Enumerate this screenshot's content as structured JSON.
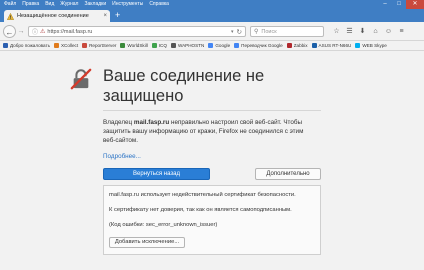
{
  "menu": [
    "Файл",
    "Правка",
    "Вид",
    "Журнал",
    "Закладки",
    "Инструменты",
    "Справка"
  ],
  "window_controls": {
    "minimize": "–",
    "maximize": "□",
    "close": "✕"
  },
  "tab": {
    "title": "Незащищённое соединение",
    "close": "×",
    "new_tab": "+"
  },
  "nav": {
    "back_glyph": "←",
    "forward_glyph": "→",
    "url": "https://mail.fasp.ru",
    "info_glyph": "ⓘ",
    "lock_glyph": "⚠",
    "dropdown_glyph": "▾",
    "reload_glyph": "↻",
    "search_icon": "⚲",
    "search_placeholder": "Поиск",
    "tool_icons": [
      {
        "name": "bookmark-star-icon",
        "glyph": "☆"
      },
      {
        "name": "reading-list-icon",
        "glyph": "☰"
      },
      {
        "name": "download-icon",
        "glyph": "⬇"
      },
      {
        "name": "home-icon",
        "glyph": "⌂"
      },
      {
        "name": "chat-icon",
        "glyph": "☺"
      },
      {
        "name": "menu-icon",
        "glyph": "≡"
      }
    ]
  },
  "bookmarks": [
    {
      "label": "Добро пожаловать",
      "color": "#2b5fb0"
    },
    {
      "label": "XCollect",
      "color": "#e07b1c"
    },
    {
      "label": "ReportServer",
      "color": "#c94a3d"
    },
    {
      "label": "WorldSkill",
      "color": "#3a8a3a"
    },
    {
      "label": "ICQ",
      "color": "#3fa34d"
    },
    {
      "label": "WAPHOSTN",
      "color": "#555555"
    },
    {
      "label": "Google",
      "color": "#4285f4"
    },
    {
      "label": "Переводчик Google",
      "color": "#4285f4"
    },
    {
      "label": "Zabbix",
      "color": "#b0272d"
    },
    {
      "label": "ASUS RT-N66U",
      "color": "#1b5fa8"
    },
    {
      "label": "WEB Skype",
      "color": "#00aff0"
    }
  ],
  "page": {
    "heading": "Ваше соединение не защищено",
    "description_owner": "Владелец",
    "description_domain": "mail.fasp.ru",
    "description_rest": "неправильно настроил свой веб-сайт. Чтобы защитить вашу информацию от кражи, Firefox не соединился с этим веб-сайтом.",
    "more_link": "Подробнее...",
    "back_button": "Вернуться назад",
    "advanced_button": "Дополнительно",
    "advanced": {
      "line1": "mail.fasp.ru использует недействительный сертификат безопасности.",
      "line2": "К сертификату нет доверия, так как он является самоподписанным.",
      "line3": "(Код ошибки: sec_error_unknown_issuer)",
      "exception_button": "Добавить исключение..."
    }
  },
  "colors": {
    "accent": "#2a7ed6",
    "titlebar": "#3f7ec4",
    "warning": "#c94a3d"
  }
}
